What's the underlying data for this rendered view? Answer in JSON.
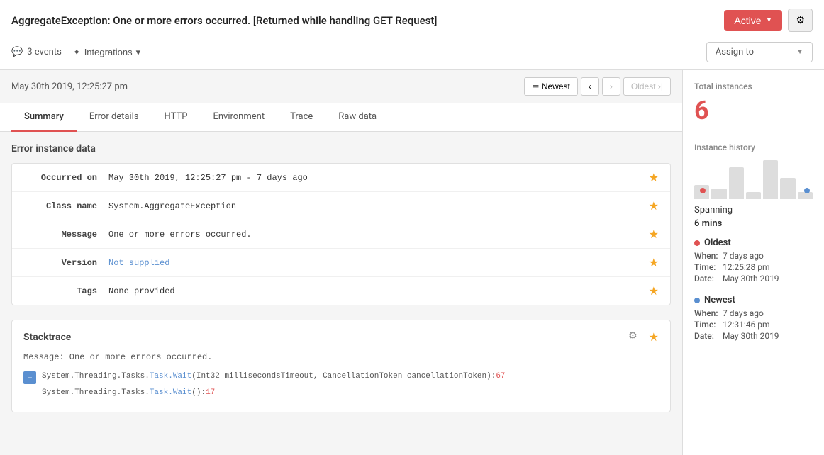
{
  "header": {
    "title": "AggregateException: One or more errors occurred. [Returned while handling GET Request]",
    "active_label": "Active",
    "gear_label": "⚙",
    "events_count": "3 events",
    "integrations_label": "Integrations",
    "assign_label": "Assign to"
  },
  "date_nav": {
    "date": "May 30th 2019, 12:25:27 pm",
    "newest_label": "⊨ Newest",
    "prev_label": "‹",
    "next_label": "›",
    "oldest_label": "Oldest ›|"
  },
  "tabs": [
    {
      "id": "summary",
      "label": "Summary",
      "active": true
    },
    {
      "id": "error-details",
      "label": "Error details",
      "active": false
    },
    {
      "id": "http",
      "label": "HTTP",
      "active": false
    },
    {
      "id": "environment",
      "label": "Environment",
      "active": false
    },
    {
      "id": "trace",
      "label": "Trace",
      "active": false
    },
    {
      "id": "raw-data",
      "label": "Raw data",
      "active": false
    }
  ],
  "error_instance": {
    "section_title": "Error instance data",
    "rows": [
      {
        "label": "Occurred on",
        "value": "May 30th 2019, 12:25:27 pm - 7 days ago",
        "starred": true
      },
      {
        "label": "Class name",
        "value": "System.AggregateException",
        "starred": true
      },
      {
        "label": "Message",
        "value": "One or more errors occurred.",
        "starred": true
      },
      {
        "label": "Version",
        "value": "Not supplied",
        "is_link": true,
        "starred": true
      },
      {
        "label": "Tags",
        "value": "None provided",
        "starred": true
      }
    ]
  },
  "stacktrace": {
    "title": "Stacktrace",
    "message": "Message: One or more errors occurred.",
    "lines": [
      {
        "has_collapse": true,
        "text": "System.Threading.Tasks.",
        "method": "Task.Wait",
        "args": "(Int32 millisecondsTimeout, CancellationToken cancellationToken)",
        "line_num": "67"
      },
      {
        "has_collapse": false,
        "text": "System.Threading.Tasks.",
        "method": "Task.Wait",
        "args": "()",
        "line_num": "17"
      }
    ]
  },
  "right_panel": {
    "total_instances_label": "Total instances",
    "total_instances_value": "6",
    "instance_history_label": "Instance history",
    "spanning_label": "Spanning",
    "spanning_value": "6 mins",
    "chart_bars": [
      20,
      15,
      45,
      10,
      55,
      30,
      10
    ],
    "oldest": {
      "label": "Oldest",
      "when_label": "When:",
      "when_value": "7 days ago",
      "time_label": "Time:",
      "time_value": "12:25:28 pm",
      "date_label": "Date:",
      "date_value": "May 30th 2019"
    },
    "newest": {
      "label": "Newest",
      "when_label": "When:",
      "when_value": "7 days ago",
      "time_label": "Time:",
      "time_value": "12:31:46 pm",
      "date_label": "Date:",
      "date_value": "May 30th 2019"
    }
  }
}
